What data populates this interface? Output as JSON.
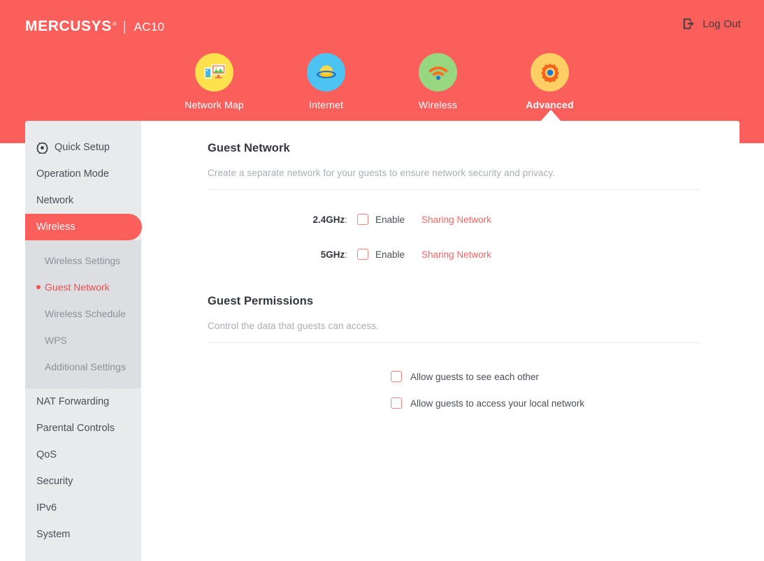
{
  "header": {
    "brand": "MERCUSYS",
    "brand_registered": "®",
    "separator": "|",
    "model": "AC10",
    "logout_label": "Log Out",
    "logout_icon": "logout-arrow-icon",
    "background_color": "#fb5f5c"
  },
  "main_nav": {
    "items": [
      {
        "label": "Network Map",
        "icon": "network-map-icon",
        "circle_color": "#ffe14d",
        "active": false
      },
      {
        "label": "Internet",
        "icon": "globe-icon",
        "circle_color": "#4cc3f0",
        "active": false
      },
      {
        "label": "Wireless",
        "icon": "wifi-icon",
        "circle_color": "#96d77f",
        "active": false
      },
      {
        "label": "Advanced",
        "icon": "gear-icon",
        "circle_color": "#ffcf63",
        "active": true
      }
    ]
  },
  "sidebar": {
    "items": [
      {
        "label": "Quick Setup",
        "icon": "gear-icon",
        "active": false
      },
      {
        "label": "Operation Mode",
        "icon": null,
        "active": false
      },
      {
        "label": "Network",
        "icon": null,
        "active": false
      },
      {
        "label": "Wireless",
        "icon": null,
        "active": true
      }
    ],
    "submenu": [
      {
        "label": "Wireless Settings",
        "current": false
      },
      {
        "label": "Guest Network",
        "current": true
      },
      {
        "label": "Wireless Schedule",
        "current": false
      },
      {
        "label": "WPS",
        "current": false
      },
      {
        "label": "Additional Settings",
        "current": false
      }
    ],
    "items_lower": [
      {
        "label": "NAT Forwarding"
      },
      {
        "label": "Parental Controls"
      },
      {
        "label": "QoS"
      },
      {
        "label": "Security"
      },
      {
        "label": "IPv6"
      },
      {
        "label": "System"
      }
    ],
    "active_color": "#fb5f5c",
    "background_color": "#e8eaec",
    "submenu_background_color": "#dcdee1"
  },
  "content": {
    "guest_network": {
      "title": "Guest Network",
      "description": "Create a separate network for your guests to ensure network security and privacy.",
      "rows": [
        {
          "band_label": "2.4GHz",
          "colon": ":",
          "enable_label": "Enable",
          "enabled": false,
          "sharing_link": "Sharing Network"
        },
        {
          "band_label": "5GHz",
          "colon": ":",
          "enable_label": "Enable",
          "enabled": false,
          "sharing_link": "Sharing Network"
        }
      ]
    },
    "guest_permissions": {
      "title": "Guest Permissions",
      "description": "Control the data that guests can access.",
      "options": [
        {
          "label": "Allow guests to see each other",
          "checked": false
        },
        {
          "label": "Allow guests to access your local network",
          "checked": false
        }
      ]
    }
  }
}
